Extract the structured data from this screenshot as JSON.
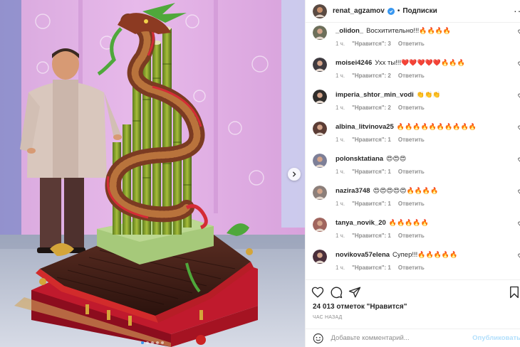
{
  "post": {
    "author": "renat_agzamov",
    "dot_separator": "•",
    "follow_label": "Подписки",
    "more_label": "···"
  },
  "comments": [
    {
      "user": "_olidon_",
      "text": "Восхитительно!!!",
      "emoji": "🔥🔥🔥🔥",
      "time": "1 ч.",
      "likes": "\"Нравится\": 3",
      "reply": "Ответить",
      "avatar_color": "#6d6f5a"
    },
    {
      "user": "moisei4246",
      "text": "Ухх ты!!!",
      "emoji": "❤️❤️❤️❤️❤️🔥🔥🔥",
      "time": "1 ч.",
      "likes": "\"Нравится\": 2",
      "reply": "Ответить",
      "avatar_color": "#3e3a3f"
    },
    {
      "user": "imperia_shtor_min_vodi",
      "text": "",
      "emoji": "👏👏👏",
      "time": "1 ч.",
      "likes": "\"Нравится\": 2",
      "reply": "Ответить",
      "avatar_color": "#2f2d2b"
    },
    {
      "user": "albina_litvinova25",
      "text": "",
      "emoji": "🔥🔥🔥🔥🔥🔥🔥🔥🔥🔥",
      "time": "1 ч.",
      "likes": "\"Нравится\": 1",
      "reply": "Ответить",
      "avatar_color": "#5b3d35"
    },
    {
      "user": "polonsktatiana",
      "text": "",
      "emoji": "😍😍😍",
      "time": "1 ч.",
      "likes": "\"Нравится\": 1",
      "reply": "Ответить",
      "avatar_color": "#7d7f97"
    },
    {
      "user": "nazira3748",
      "text": "",
      "emoji": "😍😍😍😍😍🔥🔥🔥🔥",
      "time": "1 ч.",
      "likes": "\"Нравится\": 1",
      "reply": "Ответить",
      "avatar_color": "#8c7f7a"
    },
    {
      "user": "tanya_novik_20",
      "text": "",
      "emoji": "🔥🔥🔥🔥🔥",
      "time": "1 ч.",
      "likes": "\"Нравится\": 1",
      "reply": "Ответить",
      "avatar_color": "#a0655e"
    },
    {
      "user": "novikova57elena",
      "text": "Супер!!!",
      "emoji": "🔥🔥🔥🔥🔥",
      "time": "1 ч.",
      "likes": "\"Нравится\": 1",
      "reply": "Ответить",
      "avatar_color": "#4a2f3b"
    }
  ],
  "stats": {
    "likes_text": "24 013 отметок \"Нравится\"",
    "time_ago": "час назад"
  },
  "compose": {
    "placeholder": "Добавьте комментарий...",
    "post_label": "Опубликовать"
  },
  "colors": {
    "accent": "#3897f0",
    "muted": "#8e8e8e",
    "border": "#efefef",
    "like_red": "#ed4956"
  },
  "icons": {
    "like": "heart-icon",
    "comment": "comment-icon",
    "share": "send-icon",
    "save": "bookmark-icon",
    "emoji": "smile-icon",
    "next": "chevron-right-icon"
  }
}
